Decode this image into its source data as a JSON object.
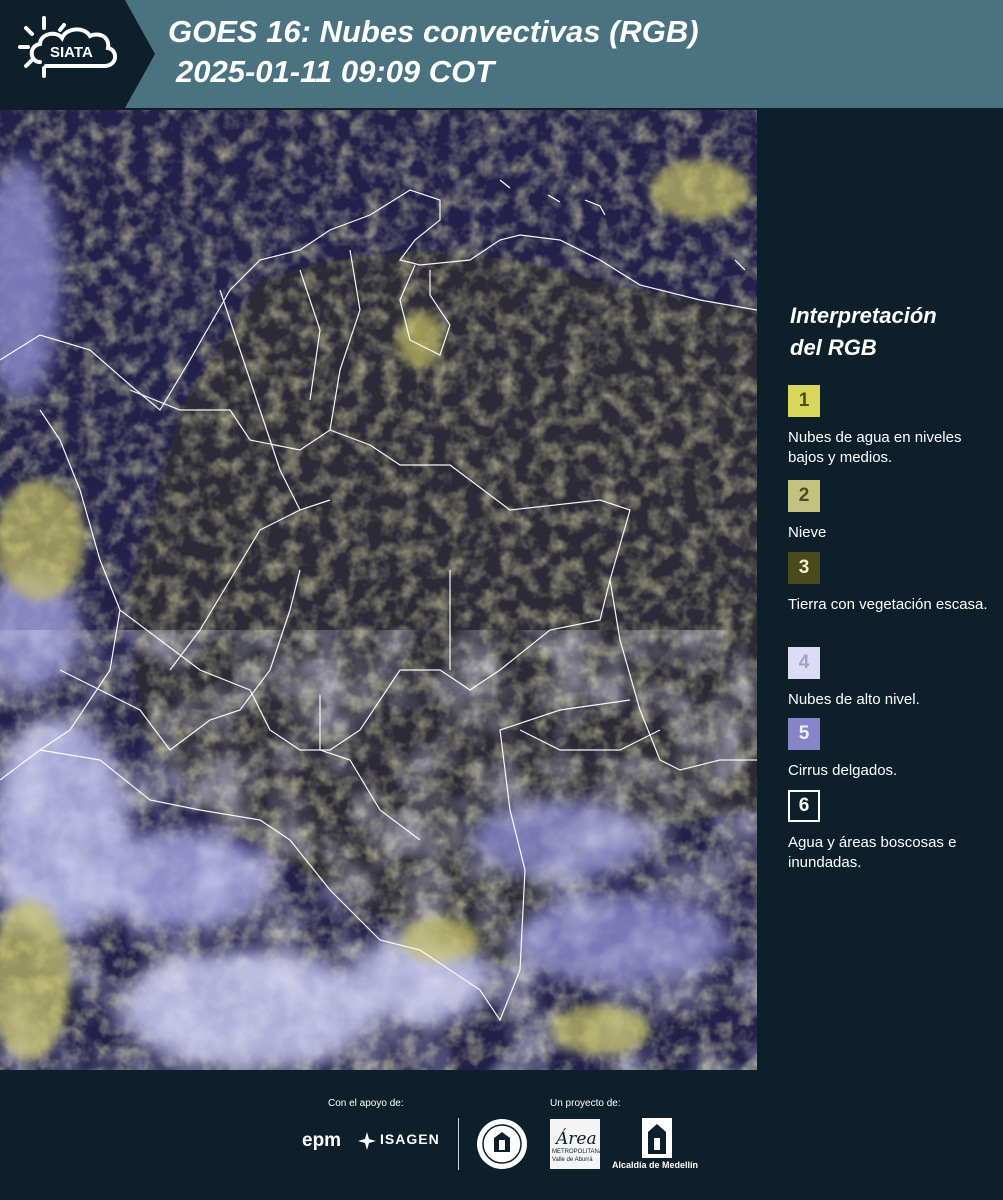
{
  "header": {
    "logo_text": "SIATA",
    "title_line1": "GOES 16: Nubes convectivas (RGB)",
    "title_line2": "2025-01-11 09:09 COT"
  },
  "map": {
    "description_icon": "satellite-rgb-imagery"
  },
  "legend": {
    "title_line1": "Interpretación",
    "title_line2": "del RGB",
    "items": [
      {
        "number": "1",
        "label": "Nubes de agua en niveles bajos y medios.",
        "color": "#d7d85a",
        "text_color": "#4a4a20"
      },
      {
        "number": "2",
        "label": "Nieve",
        "color": "#c4c282",
        "text_color": "#4a4a20"
      },
      {
        "number": "3",
        "label": "Tierra con vegetación escasa.",
        "color": "#4a4a1c",
        "text_color": "#f0f0d0"
      },
      {
        "number": "4",
        "label": "Nubes de alto nivel.",
        "color": "#dcdcf6",
        "text_color": "#a0a0c8"
      },
      {
        "number": "5",
        "label": "Cirrus delgados.",
        "color": "#8884c8",
        "text_color": "#f0f0ff"
      },
      {
        "number": "6",
        "label": "Agua y áreas boscosas e inundadas.",
        "color": "#0c1f2b",
        "text_color": "#ffffff"
      }
    ]
  },
  "footer": {
    "support_label": "Con el apoyo de:",
    "project_label": "Un proyecto de:",
    "epm_text": "epm",
    "isagen_text": "ISAGEN",
    "area_text_line1": "Área",
    "area_text_line2": "METROPOLITANA",
    "area_text_line3": "Valle de Aburrá",
    "alcaldia_text": "Alcaldía de Medellín"
  },
  "colors": {
    "header_bg": "#4a7280",
    "page_bg": "#0c1f2b",
    "map_bg": "#23214a",
    "cloud_yellow": "#c8c468",
    "cloud_white": "#c8c8f0",
    "border_white": "#ffffff"
  }
}
